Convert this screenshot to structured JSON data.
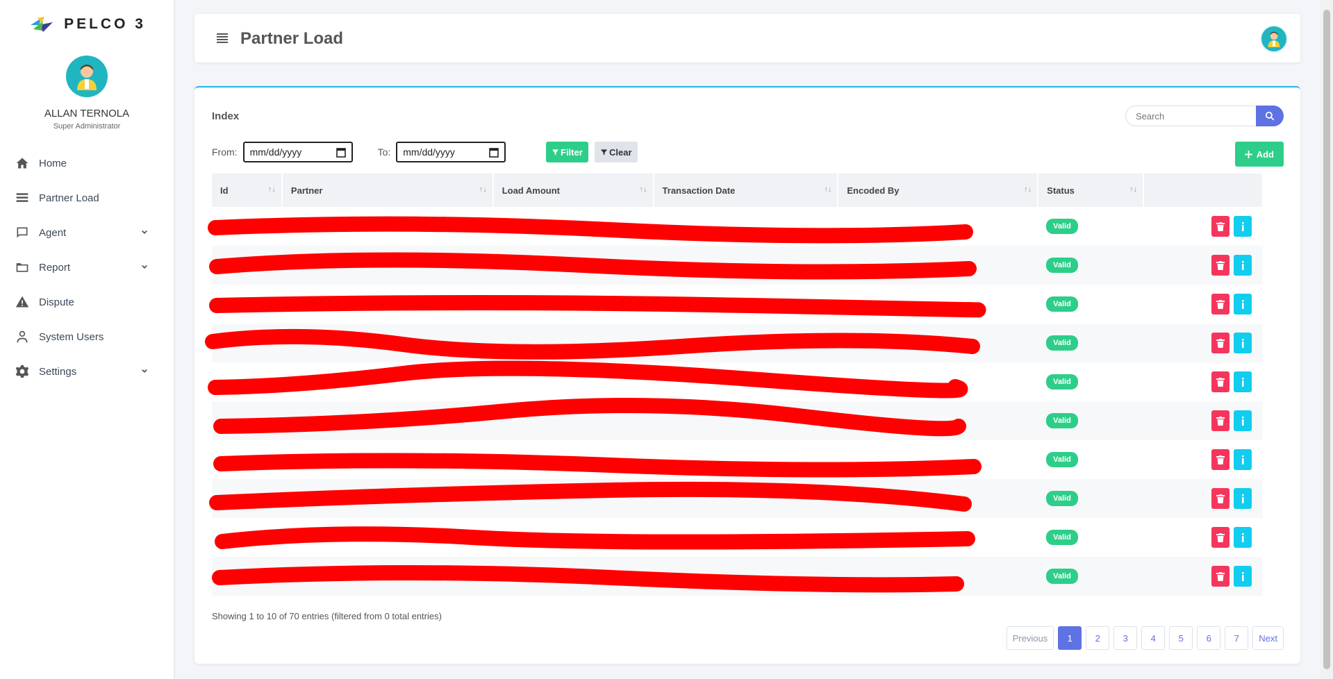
{
  "brand": {
    "name": "PELCO 3"
  },
  "user": {
    "name": "ALLAN TERNOLA",
    "role": "Super Administrator"
  },
  "nav": [
    {
      "label": "Home",
      "icon": "home-icon"
    },
    {
      "label": "Partner Load",
      "icon": "list-icon"
    },
    {
      "label": "Agent",
      "icon": "chat-icon",
      "expandable": true
    },
    {
      "label": "Report",
      "icon": "folder-icon",
      "expandable": true
    },
    {
      "label": "Dispute",
      "icon": "warning-icon"
    },
    {
      "label": "System Users",
      "icon": "user-icon"
    },
    {
      "label": "Settings",
      "icon": "gear-icon",
      "expandable": true
    }
  ],
  "header": {
    "title": "Partner Load"
  },
  "card": {
    "title": "Index",
    "search_placeholder": "Search",
    "from_label": "From:",
    "to_label": "To:",
    "from_value": "mm/dd/yyyy",
    "to_value": "mm/dd/yyyy",
    "filter_label": "Filter",
    "clear_label": "Clear",
    "add_label": "Add"
  },
  "table": {
    "columns": [
      "Id",
      "Partner",
      "Load Amount",
      "Transaction Date",
      "Encoded By",
      "Status"
    ],
    "rows": [
      {
        "status": "Valid"
      },
      {
        "status": "Valid"
      },
      {
        "status": "Valid"
      },
      {
        "status": "Valid"
      },
      {
        "status": "Valid"
      },
      {
        "status": "Valid"
      },
      {
        "status": "Valid"
      },
      {
        "status": "Valid"
      },
      {
        "status": "Valid"
      },
      {
        "status": "Valid"
      }
    ]
  },
  "footer": {
    "info": "Showing 1 to 10 of 70 entries (filtered from 0 total entries)"
  },
  "pagination": {
    "previous": "Previous",
    "pages": [
      "1",
      "2",
      "3",
      "4",
      "5",
      "6",
      "7"
    ],
    "next": "Next",
    "active": "1"
  },
  "colors": {
    "primary": "#5e72e4",
    "success": "#2dce89",
    "danger": "#f5365c",
    "info": "#11cdef",
    "redaction": "#ff0000"
  }
}
